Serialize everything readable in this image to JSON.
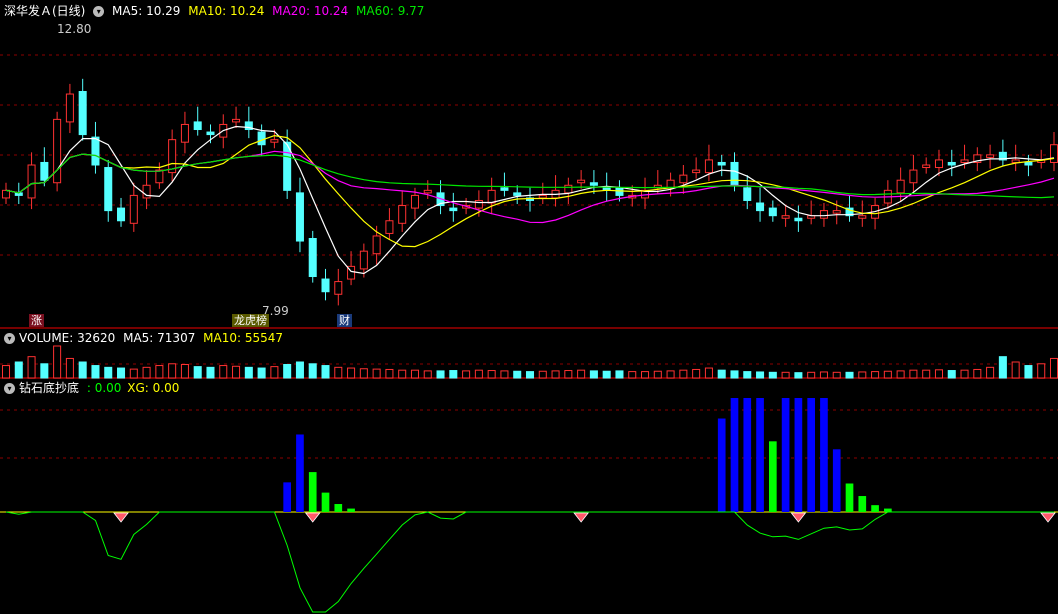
{
  "price_panel": {
    "stock_name": "深华发Ａ(日线)",
    "ma5": "MA5: 10.29",
    "ma10": "MA10: 10.24",
    "ma20": "MA20: 10.24",
    "ma60": "MA60: 9.77",
    "high_label": "12.80",
    "low_label": "7.99",
    "markers": [
      "涨",
      "龙虎榜",
      "财"
    ]
  },
  "volume_panel": {
    "title": "VOLUME: 32620",
    "ma5": "MA5: 71307",
    "ma10": "MA10: 55547"
  },
  "indicator_panel": {
    "title": "钻石底抄底",
    "value1": ": 0.00",
    "xg": "XG: 0.00"
  },
  "colors": {
    "up": "#ff3232",
    "down": "#54ffff",
    "ma5": "#ffffff",
    "ma10": "#ffff00",
    "ma20": "#ff00ff",
    "ma60": "#00e600",
    "blue_bar": "#0000ff",
    "green_bar": "#00ff00",
    "separator": "#a00000",
    "grid": "#8b0000"
  },
  "chart_data": {
    "type": "candlestick",
    "ylim": [
      7.5,
      13.3
    ],
    "high": 12.8,
    "low": 7.99,
    "closes": [
      9.9,
      9.8,
      10.4,
      10.1,
      11.3,
      11.8,
      11.0,
      10.4,
      9.5,
      9.3,
      9.8,
      10.0,
      10.3,
      10.9,
      11.2,
      11.1,
      11.0,
      11.2,
      11.3,
      11.1,
      10.8,
      10.9,
      9.9,
      8.9,
      8.2,
      7.9,
      8.1,
      8.4,
      8.7,
      9.0,
      9.3,
      9.6,
      9.8,
      9.9,
      9.6,
      9.5,
      9.6,
      9.7,
      9.9,
      9.9,
      9.8,
      9.7,
      9.8,
      9.9,
      10.0,
      10.1,
      10.0,
      9.9,
      9.8,
      9.8,
      9.9,
      10.0,
      10.1,
      10.2,
      10.3,
      10.5,
      10.4,
      10.0,
      9.7,
      9.5,
      9.4,
      9.4,
      9.3,
      9.4,
      9.5,
      9.5,
      9.4,
      9.4,
      9.6,
      9.9,
      10.1,
      10.3,
      10.4,
      10.5,
      10.4,
      10.5,
      10.6,
      10.6,
      10.5,
      10.5,
      10.4,
      10.5,
      10.8
    ],
    "volume": [
      35,
      45,
      60,
      40,
      90,
      55,
      45,
      35,
      30,
      28,
      25,
      30,
      35,
      40,
      38,
      32,
      30,
      35,
      33,
      30,
      28,
      32,
      38,
      45,
      40,
      35,
      30,
      28,
      26,
      25,
      24,
      22,
      22,
      20,
      20,
      21,
      20,
      22,
      21,
      20,
      19,
      18,
      19,
      20,
      21,
      22,
      20,
      19,
      20,
      18,
      18,
      19,
      20,
      22,
      24,
      28,
      22,
      20,
      18,
      17,
      16,
      16,
      15,
      16,
      17,
      16,
      16,
      17,
      18,
      19,
      20,
      22,
      22,
      23,
      21,
      22,
      24,
      30,
      60,
      45,
      35,
      40,
      55
    ],
    "indicator_bars": [
      {
        "i": 22,
        "v": 0.26,
        "c": "blue"
      },
      {
        "i": 23,
        "v": 0.68,
        "c": "blue"
      },
      {
        "i": 24,
        "v": 0.35,
        "c": "green"
      },
      {
        "i": 25,
        "v": 0.17,
        "c": "green"
      },
      {
        "i": 26,
        "v": 0.07,
        "c": "green"
      },
      {
        "i": 27,
        "v": 0.03,
        "c": "green"
      },
      {
        "i": 56,
        "v": 0.82,
        "c": "blue"
      },
      {
        "i": 57,
        "v": 1.0,
        "c": "blue"
      },
      {
        "i": 58,
        "v": 1.0,
        "c": "blue"
      },
      {
        "i": 59,
        "v": 1.0,
        "c": "blue"
      },
      {
        "i": 60,
        "v": 0.62,
        "c": "green"
      },
      {
        "i": 61,
        "v": 1.0,
        "c": "blue"
      },
      {
        "i": 62,
        "v": 1.0,
        "c": "blue"
      },
      {
        "i": 63,
        "v": 1.0,
        "c": "blue"
      },
      {
        "i": 64,
        "v": 1.0,
        "c": "blue"
      },
      {
        "i": 65,
        "v": 0.55,
        "c": "blue"
      },
      {
        "i": 66,
        "v": 0.25,
        "c": "green"
      },
      {
        "i": 67,
        "v": 0.14,
        "c": "green"
      },
      {
        "i": 68,
        "v": 0.06,
        "c": "green"
      },
      {
        "i": 69,
        "v": 0.03,
        "c": "green"
      }
    ],
    "diamonds": [
      9,
      24,
      45,
      62,
      84
    ]
  }
}
